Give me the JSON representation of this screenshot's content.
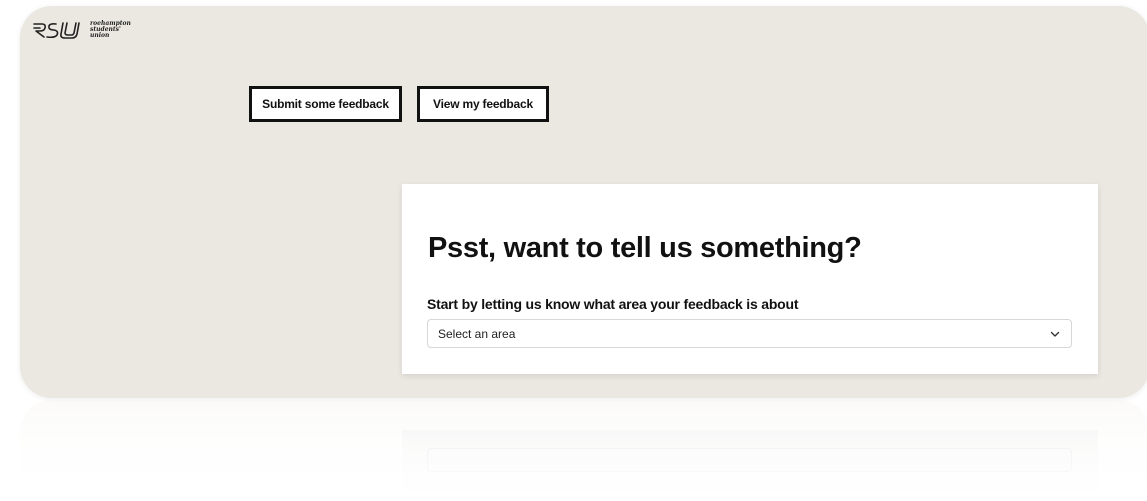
{
  "brand": {
    "logo_lines": [
      "roehampton",
      "students'",
      "union"
    ]
  },
  "tabs": [
    {
      "label": "Submit some feedback"
    },
    {
      "label": "View my feedback"
    }
  ],
  "card": {
    "title": "Psst, want to tell us something?",
    "area_label": "Start by letting us know what area your feedback is about",
    "area_select": {
      "placeholder": "Select an area"
    }
  },
  "colors": {
    "panel_background": "#ebe8e2",
    "card_background": "#ffffff",
    "button_border": "#111111"
  },
  "icons": {
    "select_toggle": "chevron-down-icon",
    "logo": "rsu-logo-icon"
  }
}
